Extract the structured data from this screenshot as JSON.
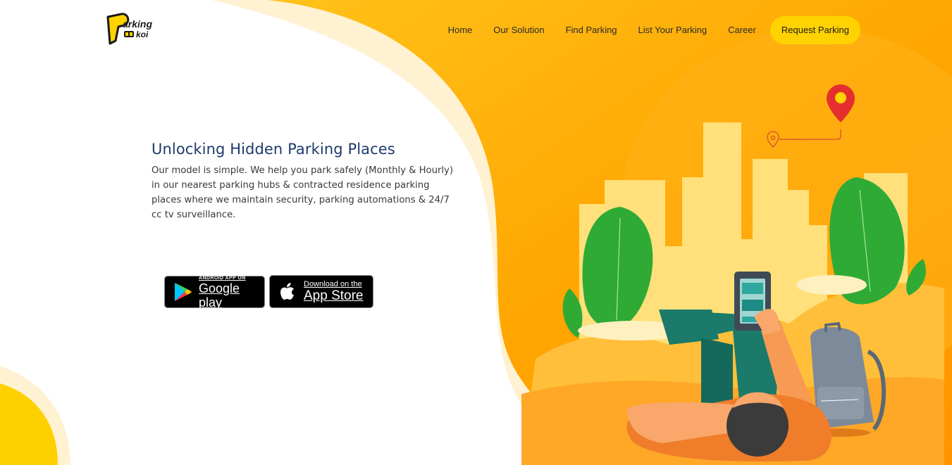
{
  "brand": {
    "logo_text_top": "arking",
    "logo_text_bottom": "koi"
  },
  "nav": {
    "items": [
      {
        "label": "Home"
      },
      {
        "label": "Our Solution"
      },
      {
        "label": "Find Parking"
      },
      {
        "label": "List Your Parking"
      },
      {
        "label": "Career"
      }
    ],
    "cta_label": "Request Parking"
  },
  "hero": {
    "title": "Unlocking Hidden Parking Places",
    "description": "Our model is simple. We help you park safely (Monthly & Hourly) in our nearest parking hubs & contracted residence parking places where we maintain security, parking automations & 24/7 cc tv surveillance."
  },
  "stores": {
    "google": {
      "small": "ANDROID APP ON",
      "big": "Google play",
      "icon": "google-play-icon"
    },
    "apple": {
      "small": "Download on the",
      "big": "App Store",
      "icon": "apple-icon"
    }
  },
  "colors": {
    "accent": "#ffd200",
    "orange": "#ff9f00",
    "title": "#1e3a6b"
  }
}
